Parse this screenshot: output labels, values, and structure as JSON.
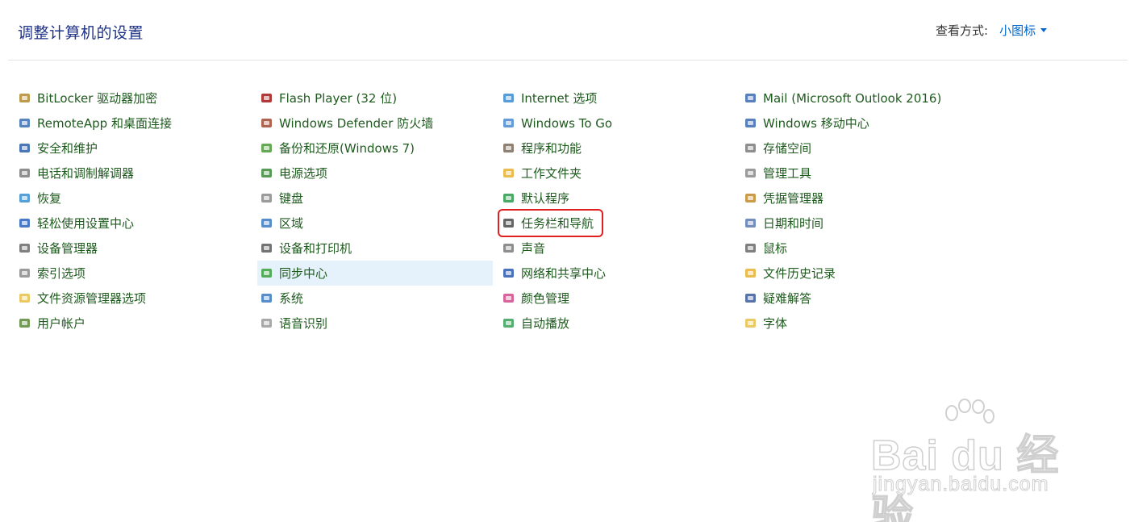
{
  "header": {
    "title": "调整计算机的设置",
    "view_by_label": "查看方式:",
    "view_by_value": "小图标"
  },
  "columns": [
    [
      {
        "label": "BitLocker 驱动器加密",
        "icon": "key-drive-icon",
        "color": "#b08a2e"
      },
      {
        "label": "RemoteApp 和桌面连接",
        "icon": "remote-desktop-icon",
        "color": "#3a6fb0"
      },
      {
        "label": "安全和维护",
        "icon": "flag-icon",
        "color": "#2b5fa8"
      },
      {
        "label": "电话和调制解调器",
        "icon": "phone-modem-icon",
        "color": "#7a7a7a"
      },
      {
        "label": "恢复",
        "icon": "recovery-icon",
        "color": "#3a8fd0"
      },
      {
        "label": "轻松使用设置中心",
        "icon": "ease-of-access-icon",
        "color": "#2b62c0"
      },
      {
        "label": "设备管理器",
        "icon": "device-manager-icon",
        "color": "#6a6a6a"
      },
      {
        "label": "索引选项",
        "icon": "indexing-icon",
        "color": "#8a8a8a"
      },
      {
        "label": "文件资源管理器选项",
        "icon": "folder-options-icon",
        "color": "#e8c04a"
      },
      {
        "label": "用户帐户",
        "icon": "user-accounts-icon",
        "color": "#5a8a3a"
      }
    ],
    [
      {
        "label": "Flash Player (32 位)",
        "icon": "flash-icon",
        "color": "#a01818"
      },
      {
        "label": "Windows Defender 防火墙",
        "icon": "firewall-icon",
        "color": "#a04a30"
      },
      {
        "label": "备份和还原(Windows 7)",
        "icon": "backup-icon",
        "color": "#4a9a3a"
      },
      {
        "label": "电源选项",
        "icon": "power-icon",
        "color": "#3a8a3a"
      },
      {
        "label": "键盘",
        "icon": "keyboard-icon",
        "color": "#8a8a8a"
      },
      {
        "label": "区域",
        "icon": "region-icon",
        "color": "#3a7ac0"
      },
      {
        "label": "设备和打印机",
        "icon": "printer-icon",
        "color": "#5a5a5a"
      },
      {
        "label": "同步中心",
        "icon": "sync-icon",
        "color": "#3aa03a"
      },
      {
        "label": "系统",
        "icon": "system-icon",
        "color": "#3a7ac0"
      },
      {
        "label": "语音识别",
        "icon": "microphone-icon",
        "color": "#9a9a9a"
      }
    ],
    [
      {
        "label": "Internet 选项",
        "icon": "internet-options-icon",
        "color": "#3a8ad0"
      },
      {
        "label": "Windows To Go",
        "icon": "windows-to-go-icon",
        "color": "#4a8ad0"
      },
      {
        "label": "程序和功能",
        "icon": "programs-icon",
        "color": "#7a6a5a"
      },
      {
        "label": "工作文件夹",
        "icon": "work-folders-icon",
        "color": "#e8b030"
      },
      {
        "label": "默认程序",
        "icon": "default-programs-icon",
        "color": "#2a9a4a"
      },
      {
        "label": "任务栏和导航",
        "icon": "taskbar-icon",
        "color": "#4a4a4a"
      },
      {
        "label": "声音",
        "icon": "sound-icon",
        "color": "#7a7a7a"
      },
      {
        "label": "网络和共享中心",
        "icon": "network-icon",
        "color": "#2a5ab0"
      },
      {
        "label": "颜色管理",
        "icon": "color-management-icon",
        "color": "#d04a8a"
      },
      {
        "label": "自动播放",
        "icon": "autoplay-icon",
        "color": "#3aa05a"
      }
    ],
    [
      {
        "label": "Mail (Microsoft Outlook 2016)",
        "icon": "mail-icon",
        "color": "#3a6ab0"
      },
      {
        "label": "Windows 移动中心",
        "icon": "mobility-center-icon",
        "color": "#3a6ab0"
      },
      {
        "label": "存储空间",
        "icon": "storage-spaces-icon",
        "color": "#7a7a7a"
      },
      {
        "label": "管理工具",
        "icon": "admin-tools-icon",
        "color": "#8a8a8a"
      },
      {
        "label": "凭据管理器",
        "icon": "credential-icon",
        "color": "#c08a2a"
      },
      {
        "label": "日期和时间",
        "icon": "clock-icon",
        "color": "#5a7ab0"
      },
      {
        "label": "鼠标",
        "icon": "mouse-icon",
        "color": "#6a6a6a"
      },
      {
        "label": "文件历史记录",
        "icon": "file-history-icon",
        "color": "#e8b030"
      },
      {
        "label": "疑难解答",
        "icon": "troubleshoot-icon",
        "color": "#3a5a9a"
      },
      {
        "label": "字体",
        "icon": "fonts-icon",
        "color": "#e8c04a"
      }
    ]
  ],
  "hovered_item": "同步中心",
  "highlighted_item": "任务栏和导航",
  "watermark": {
    "brand": "Bai du 经验",
    "url": "jingyan.baidu.com"
  },
  "colors": {
    "title": "#1e3287",
    "link": "#1e5a1e",
    "view_value": "#0066cc",
    "hover_bg": "#e5f1fb",
    "highlight_border": "#e02020"
  }
}
